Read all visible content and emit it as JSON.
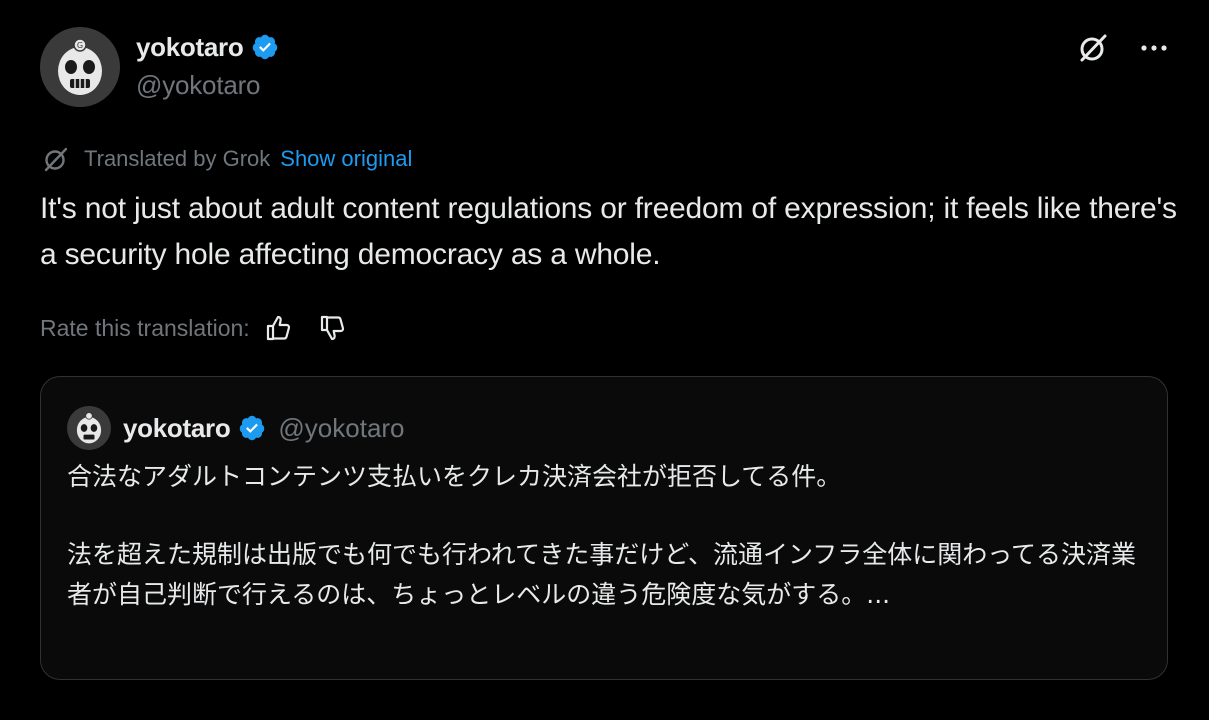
{
  "author": {
    "display_name": "yokotaro",
    "handle": "@yokotaro",
    "verified_color": "#1d9bf0"
  },
  "header_icons": {
    "grok": "grok-icon",
    "more": "more-options-icon"
  },
  "translation": {
    "label": "Translated by Grok",
    "show_original": "Show original",
    "rate_label": "Rate this translation:",
    "thumbs_up": "thumbs-up-icon",
    "thumbs_down": "thumbs-down-icon"
  },
  "post_text": "It's not just about adult content regulations or freedom of expression; it feels like there's a security hole affecting democracy as a whole.",
  "quoted_post": {
    "display_name": "yokotaro",
    "handle": "@yokotaro",
    "line1": "合法なアダルトコンテンツ支払いをクレカ決済会社が拒否してる件。",
    "line2": "法を超えた規制は出版でも何でも行われてきた事だけど、流通インフラ全体に関わってる決済業者が自己判断で行えるのは、ちょっとレベルの違う危険度な気がする。..."
  },
  "colors": {
    "background": "#000000",
    "text_primary": "#e7e9ea",
    "text_secondary": "#71767b",
    "link": "#1d9bf0",
    "border": "#2f3336"
  }
}
